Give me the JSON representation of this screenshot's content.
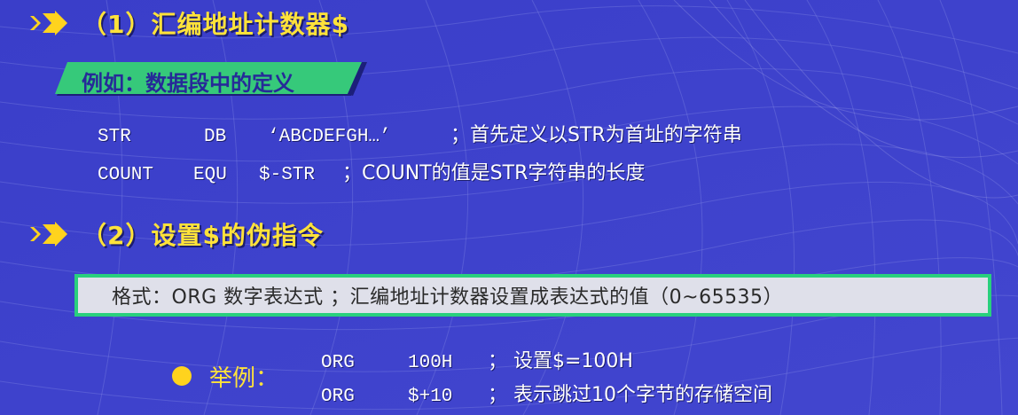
{
  "colors": {
    "background": "#3a3fc8",
    "heading": "#ffe23a",
    "tag_fill": "#34c979",
    "format_border": "#29d07d",
    "format_fill": "#dfe0ea",
    "code_text": "#ffffff",
    "bullet": "#ffd31e"
  },
  "icons": {
    "heading_marker": "double-arrow-icon",
    "bullet": "bullet-dot-icon"
  },
  "section1": {
    "title": "（1）汇编地址计数器$",
    "tag": "例如：数据段中的定义",
    "lines": [
      {
        "label": "STR",
        "op": "DB",
        "operand": "‘ABCDEFGH…’",
        "comment": "；首先定义以STR为首址的字符串"
      },
      {
        "label": "COUNT",
        "op": "EQU",
        "operand": "$-STR",
        "comment": "；COUNT的值是STR字符串的长度"
      }
    ]
  },
  "section2": {
    "title": "（2）设置$的伪指令",
    "format": "格式：ORG  数字表达式 ；汇编地址计数器设置成表达式的值（0~65535）",
    "example_label": "举例：",
    "examples": [
      {
        "op": "ORG",
        "operand": "100H",
        "comment": "； 设置$=100H"
      },
      {
        "op": "ORG",
        "operand": "$+10",
        "comment": "； 表示跳过10个字节的存储空间"
      }
    ]
  }
}
